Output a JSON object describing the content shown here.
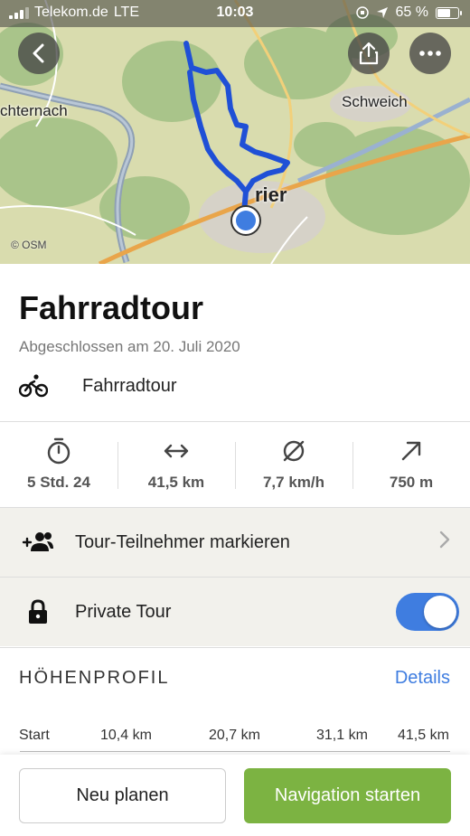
{
  "status_bar": {
    "carrier": "Telekom.de",
    "network": "LTE",
    "time": "10:03",
    "battery": "65 %",
    "battery_level": 0.65
  },
  "map": {
    "labels": {
      "echternach": "chternach",
      "schweich": "Schweich",
      "trier": "rier"
    },
    "attribution": "© OSM",
    "route_color": "#1f50d6"
  },
  "tour": {
    "title": "Fahrradtour",
    "subtitle": "Abgeschlossen am 20. Juli 2020",
    "sport": "Fahrradtour"
  },
  "stats": [
    {
      "icon": "stopwatch-icon",
      "value": "5 Std. 24"
    },
    {
      "icon": "distance-arrows-icon",
      "value": "41,5 km"
    },
    {
      "icon": "average-speed-icon",
      "value": "7,7 km/h"
    },
    {
      "icon": "elevation-up-icon",
      "value": "750 m"
    }
  ],
  "rows": {
    "participants": "Tour-Teilnehmer markieren",
    "private": "Private Tour",
    "private_on": true
  },
  "elevation": {
    "header": "HÖHENPROFIL",
    "details": "Details",
    "axis": [
      "Start",
      "10,4 km",
      "20,7 km",
      "31,1 km",
      "41,5 km"
    ]
  },
  "buttons": {
    "replan": "Neu planen",
    "navigate": "Navigation starten"
  },
  "colors": {
    "accent": "#3f7de0",
    "primary_button": "#7cb342"
  }
}
